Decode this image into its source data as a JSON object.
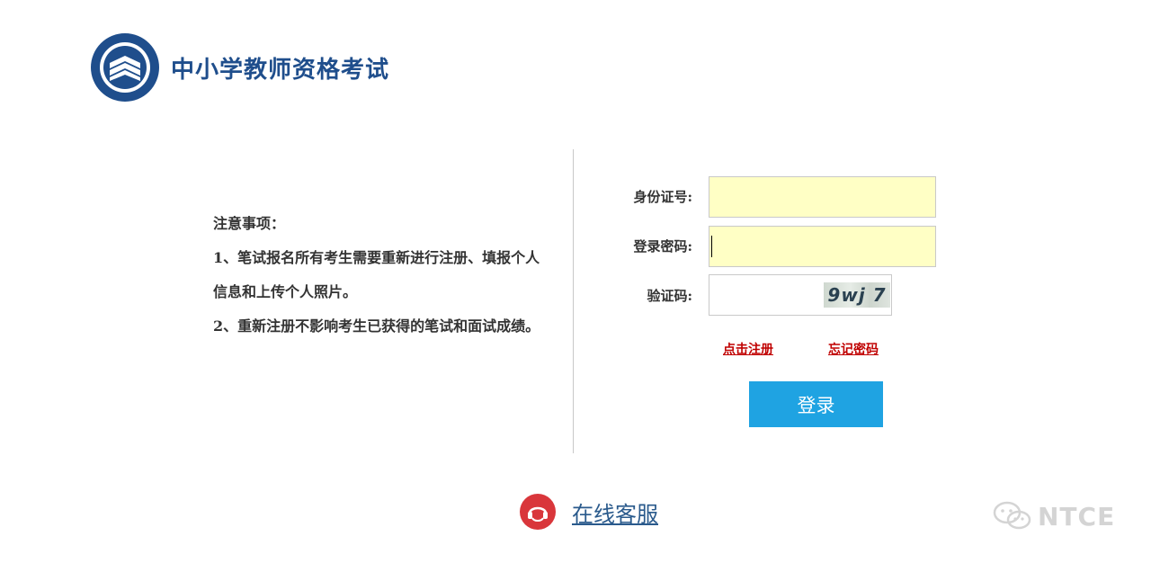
{
  "header": {
    "title": "中小学教师资格考试"
  },
  "notice": {
    "heading": "注意事项：",
    "items": [
      "1、笔试报名所有考生需要重新进行注册、填报个人信息和上传个人照片。",
      "2、重新注册不影响考生已获得的笔试和面试成绩。"
    ]
  },
  "form": {
    "id_label": "身份证号:",
    "id_value": "",
    "password_label": "登录密码:",
    "password_value": "",
    "captcha_label": "验证码:",
    "captcha_value": "",
    "captcha_text": "9wj 7",
    "register_link": "点击注册",
    "forgot_link": "忘记密码",
    "login_button": "登录"
  },
  "support": {
    "label": "在线客服"
  },
  "watermark": {
    "text": "NTCE",
    "icon": "wechat-icon"
  },
  "colors": {
    "brand": "#1f4e8c",
    "input_bg": "#ffffc5",
    "login_button": "#1fa3e2",
    "link_red": "#c00000",
    "service_icon": "#d9363b"
  }
}
